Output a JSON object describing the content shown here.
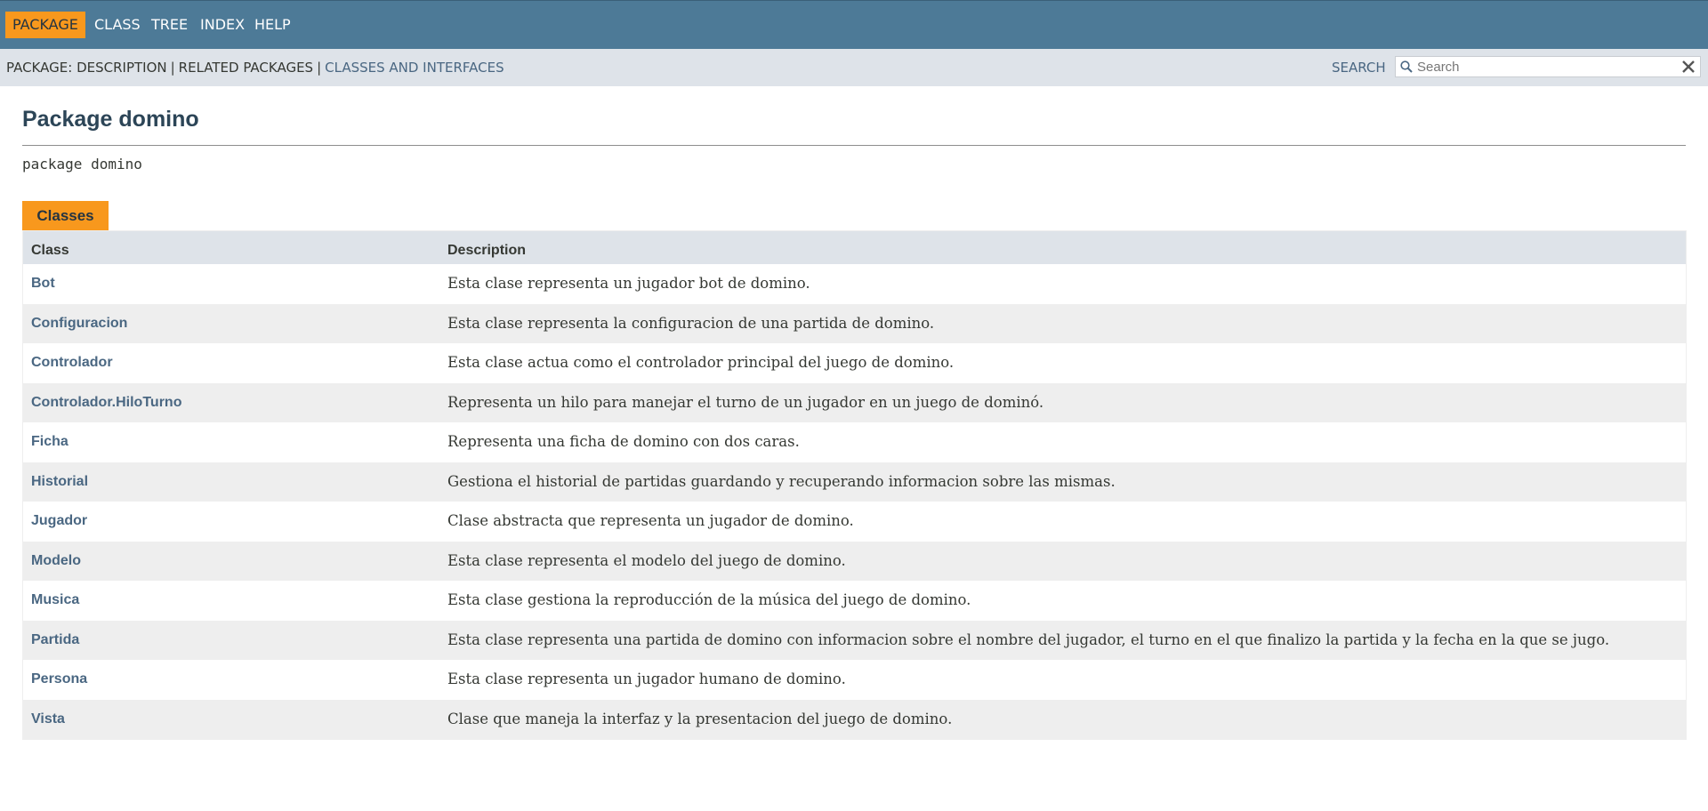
{
  "top_nav": {
    "items": [
      {
        "label": "PACKAGE",
        "active": true
      },
      {
        "label": "CLASS",
        "active": false
      },
      {
        "label": "TREE",
        "active": false
      },
      {
        "label": "INDEX",
        "active": false
      },
      {
        "label": "HELP",
        "active": false
      }
    ]
  },
  "sub_nav": {
    "package_label": "PACKAGE:",
    "description": "DESCRIPTION",
    "separator": "|",
    "related": "RELATED PACKAGES",
    "classes_link": "CLASSES AND INTERFACES",
    "search_label": "SEARCH",
    "search_placeholder": "Search",
    "search_value": ""
  },
  "header": {
    "title": "Package domino",
    "signature": "package domino"
  },
  "summary": {
    "tab_label": "Classes",
    "columns": [
      "Class",
      "Description"
    ],
    "rows": [
      {
        "name": "Bot",
        "description": "Esta clase representa un jugador bot de domino."
      },
      {
        "name": "Configuracion",
        "description": "Esta clase representa la configuracion de una partida de domino."
      },
      {
        "name": "Controlador",
        "description": "Esta clase actua como el controlador principal del juego de domino."
      },
      {
        "name": "Controlador.HiloTurno",
        "description": "Representa un hilo para manejar el turno de un jugador en un juego de dominó."
      },
      {
        "name": "Ficha",
        "description": "Representa una ficha de domino con dos caras."
      },
      {
        "name": "Historial",
        "description": "Gestiona el historial de partidas guardando y recuperando informacion sobre las mismas."
      },
      {
        "name": "Jugador",
        "description": "Clase abstracta que representa un jugador de domino."
      },
      {
        "name": "Modelo",
        "description": "Esta clase representa el modelo del juego de domino."
      },
      {
        "name": "Musica",
        "description": "Esta clase gestiona la reproducción de la música del juego de domino."
      },
      {
        "name": "Partida",
        "description": "Esta clase representa una partida de domino con informacion sobre el nombre del jugador, el turno en el que finalizo la partida y la fecha en la que se jugo."
      },
      {
        "name": "Persona",
        "description": "Esta clase representa un jugador humano de domino."
      },
      {
        "name": "Vista",
        "description": "Clase que maneja la interfaz y la presentacion del juego de domino."
      }
    ]
  },
  "colors": {
    "nav_bg": "#4d7a97",
    "accent": "#f8981d",
    "subnav_bg": "#dee3e9",
    "link": "#4a6782",
    "title": "#2c4557"
  },
  "icons": [
    "magnifier-icon",
    "reset-x-icon"
  ]
}
